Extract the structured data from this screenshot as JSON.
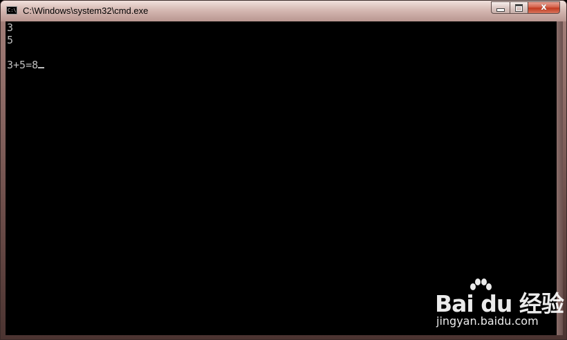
{
  "window": {
    "title": "C:\\Windows\\system32\\cmd.exe",
    "icon": "cmd-icon",
    "icon_text": "C:\\"
  },
  "controls": {
    "minimize_icon": "minimize-icon",
    "maximize_icon": "maximize-icon",
    "close_icon": "close-icon",
    "close_glyph": "x"
  },
  "console": {
    "lines": [
      "3",
      "5",
      "",
      "3+5=8"
    ],
    "text_color": "#c0c0c0",
    "background": "#000000"
  },
  "watermark": {
    "logo_text": "Bai du 经验",
    "url": "jingyan.baidu.com"
  }
}
